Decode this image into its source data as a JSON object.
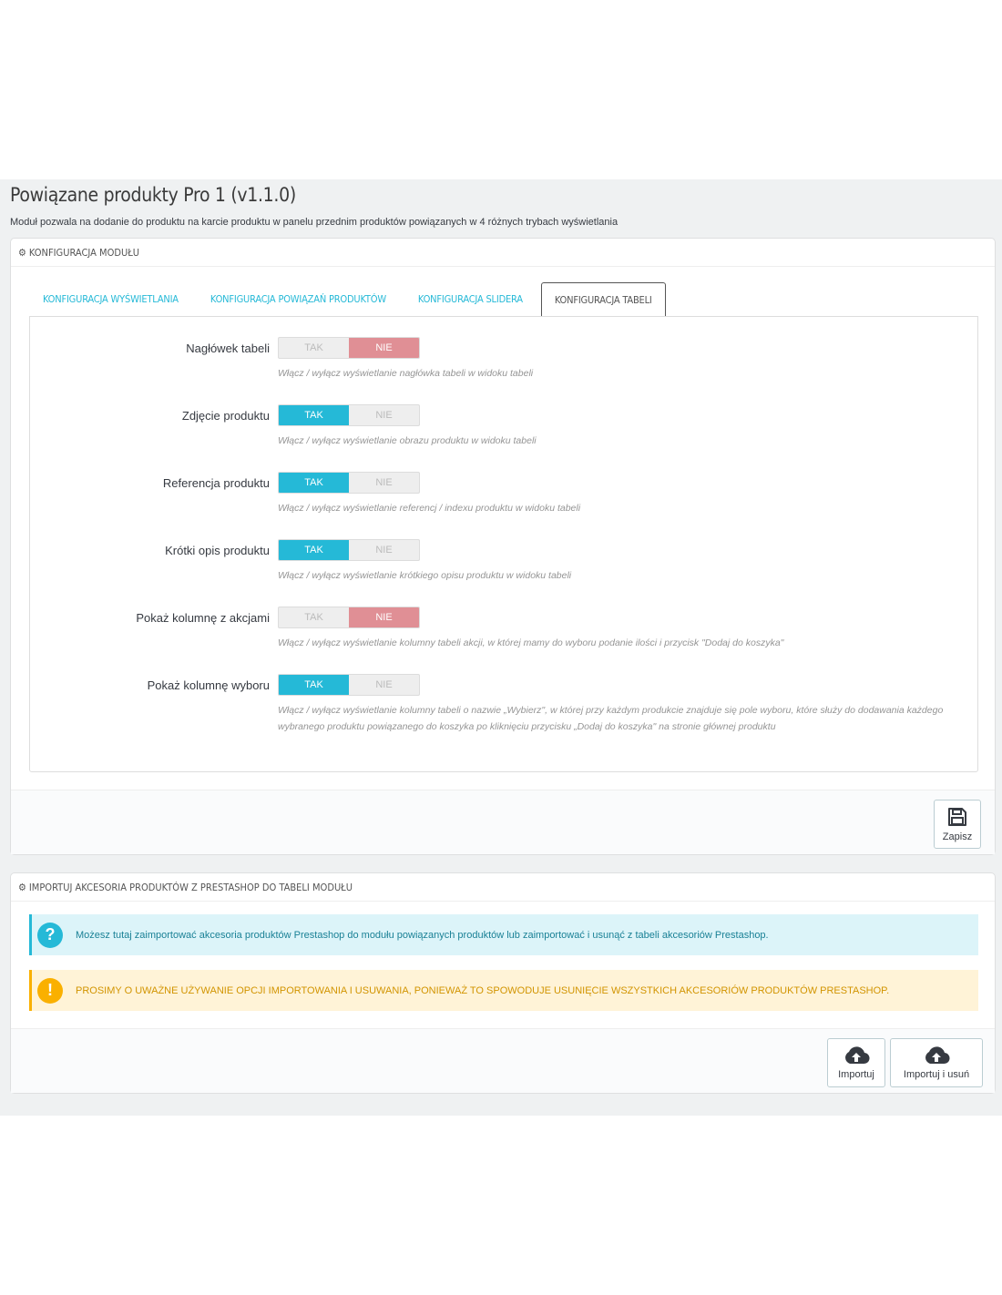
{
  "page": {
    "title": "Powiązane produkty Pro 1 (v1.1.0)",
    "description": "Moduł pozwala na dodanie do produktu na karcie produktu w panelu przednim produktów powiązanych w 4 różnych trybach wyświetlania"
  },
  "config_panel": {
    "heading": "KONFIGURACJA MODUŁU",
    "heading_icon": "gears-icon",
    "tabs": [
      {
        "label": "KONFIGURACJA WYŚWIETLANIA",
        "active": false
      },
      {
        "label": "KONFIGURACJA POWIĄZAŃ PRODUKTÓW",
        "active": false
      },
      {
        "label": "KONFIGURACJA SLIDERA",
        "active": false
      },
      {
        "label": "KONFIGURACJA TABELI",
        "active": true
      }
    ],
    "switch_yes": "TAK",
    "switch_no": "NIE",
    "fields": [
      {
        "label": "Nagłówek tabeli",
        "value": "NIE",
        "help": "Włącz / wyłącz wyświetlanie nagłówka tabeli w widoku tabeli"
      },
      {
        "label": "Zdjęcie produktu",
        "value": "TAK",
        "help": "Włącz / wyłącz wyświetlanie obrazu produktu w widoku tabeli"
      },
      {
        "label": "Referencja produktu",
        "value": "TAK",
        "help": "Włącz / wyłącz wyświetlanie referencj / indexu produktu w widoku tabeli"
      },
      {
        "label": "Krótki opis produktu",
        "value": "TAK",
        "help": "Włącz / wyłącz wyświetlanie krótkiego opisu produktu w widoku tabeli"
      },
      {
        "label": "Pokaż kolumnę z akcjami",
        "value": "NIE",
        "help": "Włącz / wyłącz wyświetlanie kolumny tabeli akcji, w której mamy do wyboru podanie ilości i przycisk \"Dodaj do koszyka\""
      },
      {
        "label": "Pokaż kolumnę wyboru",
        "value": "TAK",
        "help": "Włącz / wyłącz wyświetlanie kolumny tabeli o nazwie „Wybierz\", w której przy każdym produkcie znajduje się pole wyboru, które służy do dodawania każdego wybranego produktu powiązanego do koszyka po kliknięciu przycisku „Dodaj do koszyka\" na stronie głównej produktu"
      }
    ],
    "save_label": "Zapisz",
    "save_icon": "save-icon"
  },
  "import_panel": {
    "heading": "IMPORTUJ AKCESORIA PRODUKTÓW Z PRESTASHOP DO TABELI MODUŁU",
    "heading_icon": "gears-icon",
    "info_icon": "?",
    "info_text": "Możesz tutaj zaimportować akcesoria produktów Prestashop do modułu powiązanych produktów lub zaimportować i usunąć z tabeli akcesoriów Prestashop.",
    "warning_icon": "!",
    "warning_text": "PROSIMY O UWAŻNE UŻYWANIE OPCJI IMPORTOWANIA I USUWANIA, PONIEWAŻ TO SPOWODUJE USUNIĘCIE WSZYSTKICH AKCESORIÓW PRODUKTÓW PRESTASHOP.",
    "import_label": "Importuj",
    "import_delete_label": "Importuj i usuń",
    "upload_icon": "cloud-upload-icon"
  },
  "colors": {
    "accent": "#25b9d7",
    "no_active": "#e08f95",
    "warning": "#fab000"
  }
}
